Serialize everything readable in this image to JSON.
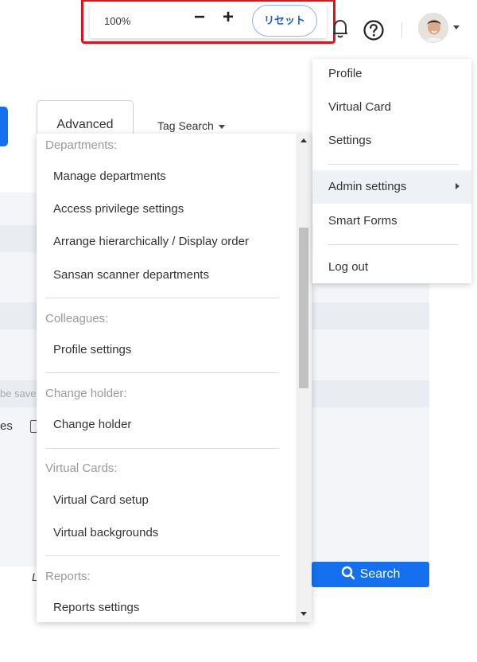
{
  "zoom": {
    "level": "100%",
    "minus": "−",
    "plus": "+",
    "reset": "リセット"
  },
  "toolbar": {
    "bell_icon": "bell-icon",
    "help_icon": "help-icon",
    "avatar_icon": "avatar"
  },
  "search": {
    "advanced": "Advanced",
    "tag_search": "Tag Search",
    "search_button": "Search",
    "save_hint": "be save",
    "checkbox_label": "es",
    "left_text": "L"
  },
  "admin_menu": {
    "sections": [
      {
        "head": "Departments:",
        "items": [
          "Manage departments",
          "Access privilege settings",
          "Arrange hierarchically / Display order",
          "Sansan scanner departments"
        ]
      },
      {
        "head": "Colleagues:",
        "items": [
          "Profile settings"
        ]
      },
      {
        "head": "Change holder:",
        "items": [
          "Change holder"
        ]
      },
      {
        "head": "Virtual Cards:",
        "items": [
          "Virtual Card setup",
          "Virtual backgrounds"
        ]
      },
      {
        "head": "Reports:",
        "items": [
          "Reports settings"
        ]
      }
    ]
  },
  "user_menu": {
    "items": [
      "Profile",
      "Virtual Card",
      "Settings",
      "Admin settings",
      "Smart Forms",
      "Log out"
    ]
  },
  "colors": {
    "accent": "#1570ef",
    "highlight_border": "#d9151d"
  }
}
